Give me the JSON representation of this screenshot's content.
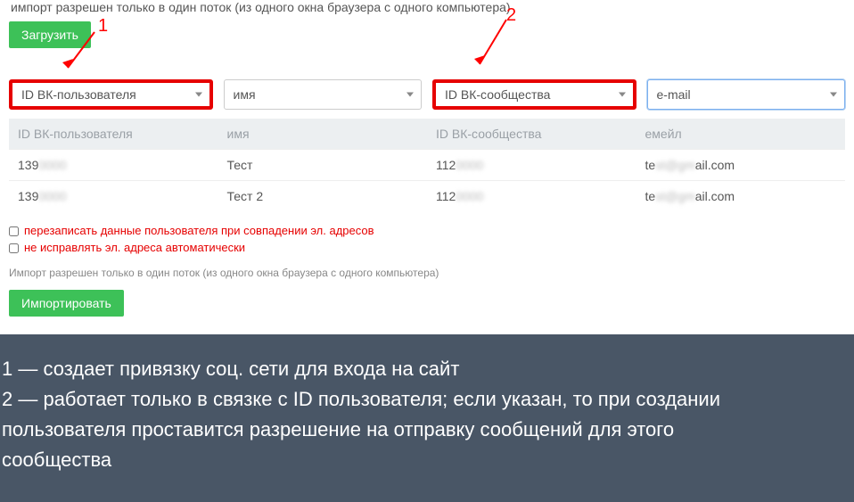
{
  "topNote": "импорт разрешен только в один поток (из одного окна браузера с одного компьютера)",
  "loadBtn": "Загрузить",
  "annot1": "1",
  "annot2": "2",
  "selects": {
    "s1": "ID ВК-пользователя",
    "s2": "имя",
    "s3": "ID ВК-сообщества",
    "s4": "e-mail"
  },
  "tableHeaders": {
    "h1": "ID ВК-пользователя",
    "h2": "имя",
    "h3": "ID ВК-сообщества",
    "h4": "емейл"
  },
  "rows": [
    {
      "c1a": "139",
      "c1b": "0000",
      "c2": "Тест",
      "c3a": "112",
      "c3b": "0000",
      "c4a": "te",
      "c4b": "st@gm",
      "c4c": "ail.com"
    },
    {
      "c1a": "139",
      "c1b": "0000",
      "c2": "Тест 2",
      "c3a": "112",
      "c3b": "0000",
      "c4a": "te",
      "c4b": "st@gm",
      "c4c": "ail.com"
    }
  ],
  "options": {
    "overwrite": "перезаписать данные пользователя при совпадении эл. адресов",
    "nofix": "не исправлять эл. адреса автоматически"
  },
  "smallNote": "Импорт разрешен только в один поток (из одного окна браузера с одного компьютера)",
  "importBtn": "Импортировать",
  "footer": {
    "l1": "1 — создает привязку соц. сети для входа на сайт",
    "l2": "2 — работает только в связке с ID пользователя; если указан, то при создании",
    "l3": "пользователя проставится разрешение на отправку сообщений для этого",
    "l4": "сообщества"
  }
}
